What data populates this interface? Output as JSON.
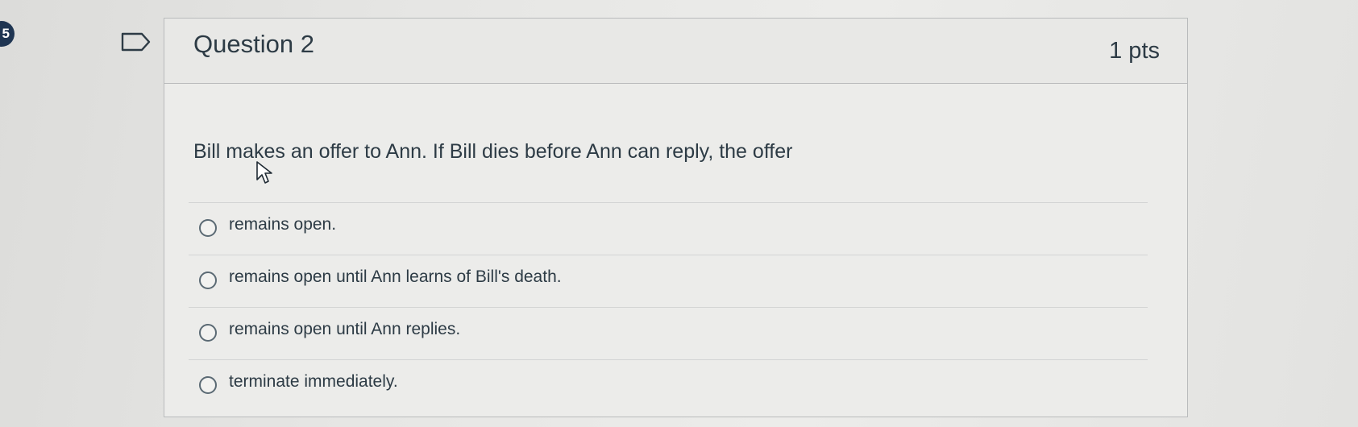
{
  "sidebar": {
    "badge_text": "5"
  },
  "question": {
    "title": "Question 2",
    "points": "1 pts",
    "text": "Bill makes an offer to Ann. If Bill dies before Ann can reply, the offer",
    "answers": [
      {
        "label": "remains open."
      },
      {
        "label": "remains open until Ann learns of Bill's death."
      },
      {
        "label": "remains open until Ann replies."
      },
      {
        "label": "terminate immediately."
      }
    ]
  },
  "icons": {
    "flag": "flag-icon",
    "cursor": "mouse-pointer-icon"
  }
}
